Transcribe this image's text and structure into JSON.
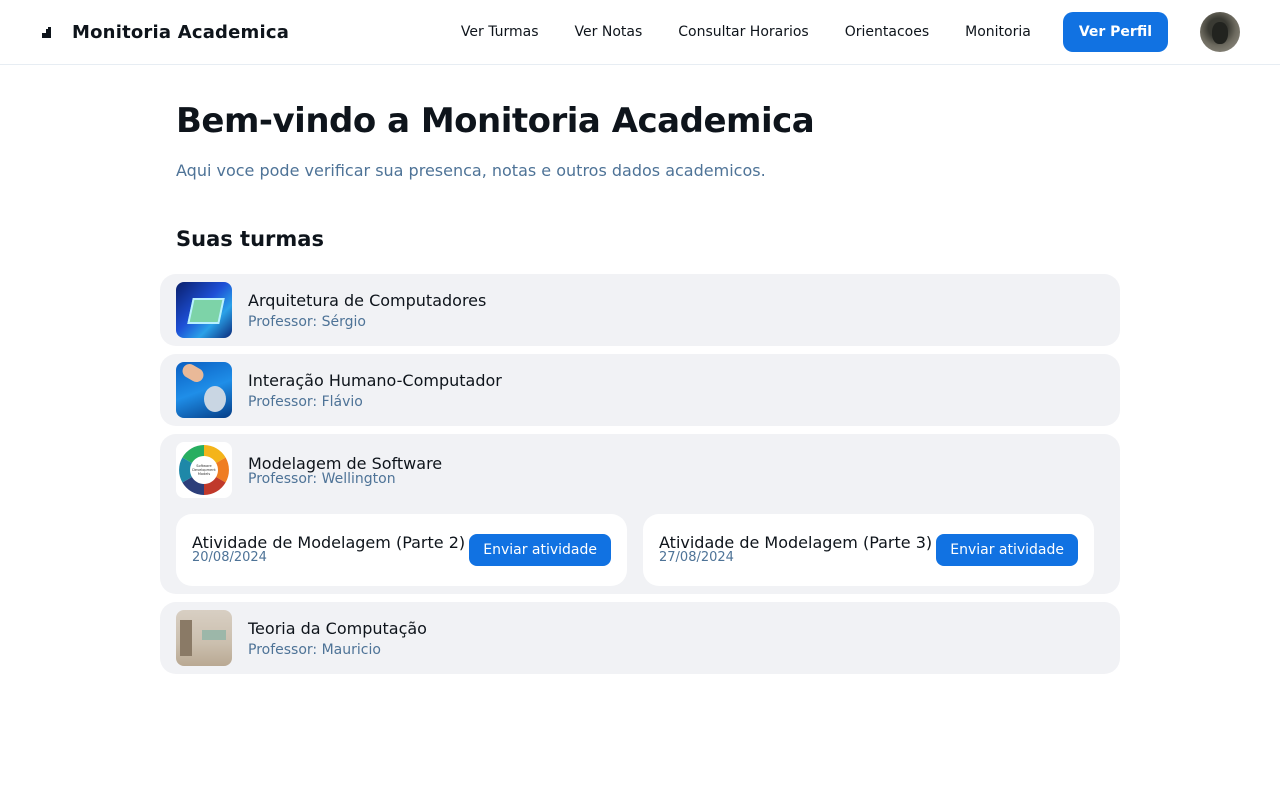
{
  "header": {
    "app_title": "Monitoria Academica",
    "logo_icon": "bar-chart-icon",
    "nav": [
      {
        "label": "Ver Turmas"
      },
      {
        "label": "Ver Notas"
      },
      {
        "label": "Consultar Horarios"
      },
      {
        "label": "Orientacoes"
      },
      {
        "label": "Monitoria"
      }
    ],
    "profile_button": "Ver Perfil",
    "accent_color": "#1172e2"
  },
  "main": {
    "title": "Bem-vindo a Monitoria Academica",
    "subtitle": "Aqui voce pode verificar sua presenca, notas e outros dados academicos.",
    "section_title": "Suas turmas",
    "classes": [
      {
        "name": "Arquitetura de Computadores",
        "professor": "Professor: Sérgio"
      },
      {
        "name": "Interação Humano-Computador",
        "professor": "Professor: Flávio"
      },
      {
        "name": "Modelagem de Software",
        "professor": "Professor: Wellington",
        "thumbnail_text": [
          "Software",
          "Development",
          "Models"
        ],
        "activities": [
          {
            "name": "Atividade de Modelagem (Parte 2)",
            "date": "20/08/2024",
            "button": "Enviar atividade"
          },
          {
            "name": "Atividade de Modelagem (Parte 3)",
            "date": "27/08/2024",
            "button": "Enviar atividade"
          }
        ]
      },
      {
        "name": "Teoria da Computação",
        "professor": "Professor: Mauricio"
      }
    ]
  }
}
